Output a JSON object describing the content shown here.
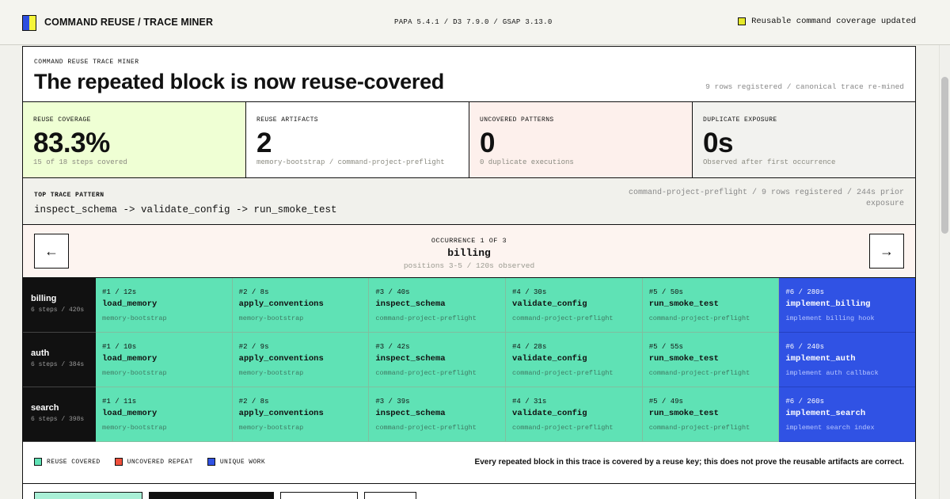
{
  "header": {
    "title": "COMMAND REUSE / TRACE MINER",
    "versions": "PAPA 5.4.1 / D3 7.9.0 / GSAP 3.13.0",
    "status": "Reusable command coverage updated",
    "logo_colors": [
      "#2d4fe0",
      "#f5f53a"
    ]
  },
  "hero": {
    "eyebrow": "COMMAND REUSE TRACE MINER",
    "headline": "The repeated block is now reuse-covered",
    "meta": "9 rows registered / canonical trace re-mined"
  },
  "metrics": [
    {
      "label": "REUSE COVERAGE",
      "value": "83.3%",
      "sub": "15 of 18 steps covered",
      "bg": "#efffd4"
    },
    {
      "label": "REUSE ARTIFACTS",
      "value": "2",
      "sub": "memory-bootstrap / command-project-preflight",
      "bg": "#ffffff"
    },
    {
      "label": "UNCOVERED PATTERNS",
      "value": "0",
      "sub": "0 duplicate executions",
      "bg": "#fdf0ec"
    },
    {
      "label": "DUPLICATE EXPOSURE",
      "value": "0s",
      "sub": "Observed after first occurrence",
      "bg": "#f2f2ef"
    }
  ],
  "pattern": {
    "label": "TOP TRACE PATTERN",
    "sequence": "inspect_schema -> validate_config -> run_smoke_test",
    "meta": "command-project-preflight / 9 rows registered / 244s prior exposure"
  },
  "occurrence": {
    "label": "OCCURRENCE 1 OF 3",
    "title": "billing",
    "sub": "positions 3-5 / 120s observed",
    "prev": "←",
    "next": "→"
  },
  "rows": [
    {
      "name": "billing",
      "sub": "6 steps / 420s",
      "cells": [
        {
          "pos": "#1 / 12s",
          "cmd": "load_memory",
          "key": "memory-bootstrap",
          "kind": "covered"
        },
        {
          "pos": "#2 / 8s",
          "cmd": "apply_conventions",
          "key": "memory-bootstrap",
          "kind": "covered"
        },
        {
          "pos": "#3 / 40s",
          "cmd": "inspect_schema",
          "key": "command-project-preflight",
          "kind": "covered"
        },
        {
          "pos": "#4 / 30s",
          "cmd": "validate_config",
          "key": "command-project-preflight",
          "kind": "covered"
        },
        {
          "pos": "#5 / 50s",
          "cmd": "run_smoke_test",
          "key": "command-project-preflight",
          "kind": "covered"
        },
        {
          "pos": "#6 / 280s",
          "cmd": "implement_billing",
          "key": "implement billing hook",
          "kind": "unique"
        }
      ]
    },
    {
      "name": "auth",
      "sub": "6 steps / 384s",
      "cells": [
        {
          "pos": "#1 / 10s",
          "cmd": "load_memory",
          "key": "memory-bootstrap",
          "kind": "covered"
        },
        {
          "pos": "#2 / 9s",
          "cmd": "apply_conventions",
          "key": "memory-bootstrap",
          "kind": "covered"
        },
        {
          "pos": "#3 / 42s",
          "cmd": "inspect_schema",
          "key": "command-project-preflight",
          "kind": "covered"
        },
        {
          "pos": "#4 / 28s",
          "cmd": "validate_config",
          "key": "command-project-preflight",
          "kind": "covered"
        },
        {
          "pos": "#5 / 55s",
          "cmd": "run_smoke_test",
          "key": "command-project-preflight",
          "kind": "covered"
        },
        {
          "pos": "#6 / 240s",
          "cmd": "implement_auth",
          "key": "implement auth callback",
          "kind": "unique"
        }
      ]
    },
    {
      "name": "search",
      "sub": "6 steps / 398s",
      "cells": [
        {
          "pos": "#1 / 11s",
          "cmd": "load_memory",
          "key": "memory-bootstrap",
          "kind": "covered"
        },
        {
          "pos": "#2 / 8s",
          "cmd": "apply_conventions",
          "key": "memory-bootstrap",
          "kind": "covered"
        },
        {
          "pos": "#3 / 39s",
          "cmd": "inspect_schema",
          "key": "command-project-preflight",
          "kind": "covered"
        },
        {
          "pos": "#4 / 31s",
          "cmd": "validate_config",
          "key": "command-project-preflight",
          "kind": "covered"
        },
        {
          "pos": "#5 / 49s",
          "cmd": "run_smoke_test",
          "key": "command-project-preflight",
          "kind": "covered"
        },
        {
          "pos": "#6 / 260s",
          "cmd": "implement_search",
          "key": "implement search index",
          "kind": "unique"
        }
      ]
    }
  ],
  "legend": [
    {
      "label": "REUSE COVERED",
      "color": "#5fe2b5"
    },
    {
      "label": "UNCOVERED REPEAT",
      "color": "#f0503c"
    },
    {
      "label": "UNIQUE WORK",
      "color": "#3052e4"
    }
  ],
  "note": "Every repeated block in this trace is covered by a reuse key; this does not prove the reusable artifacts are correct."
}
